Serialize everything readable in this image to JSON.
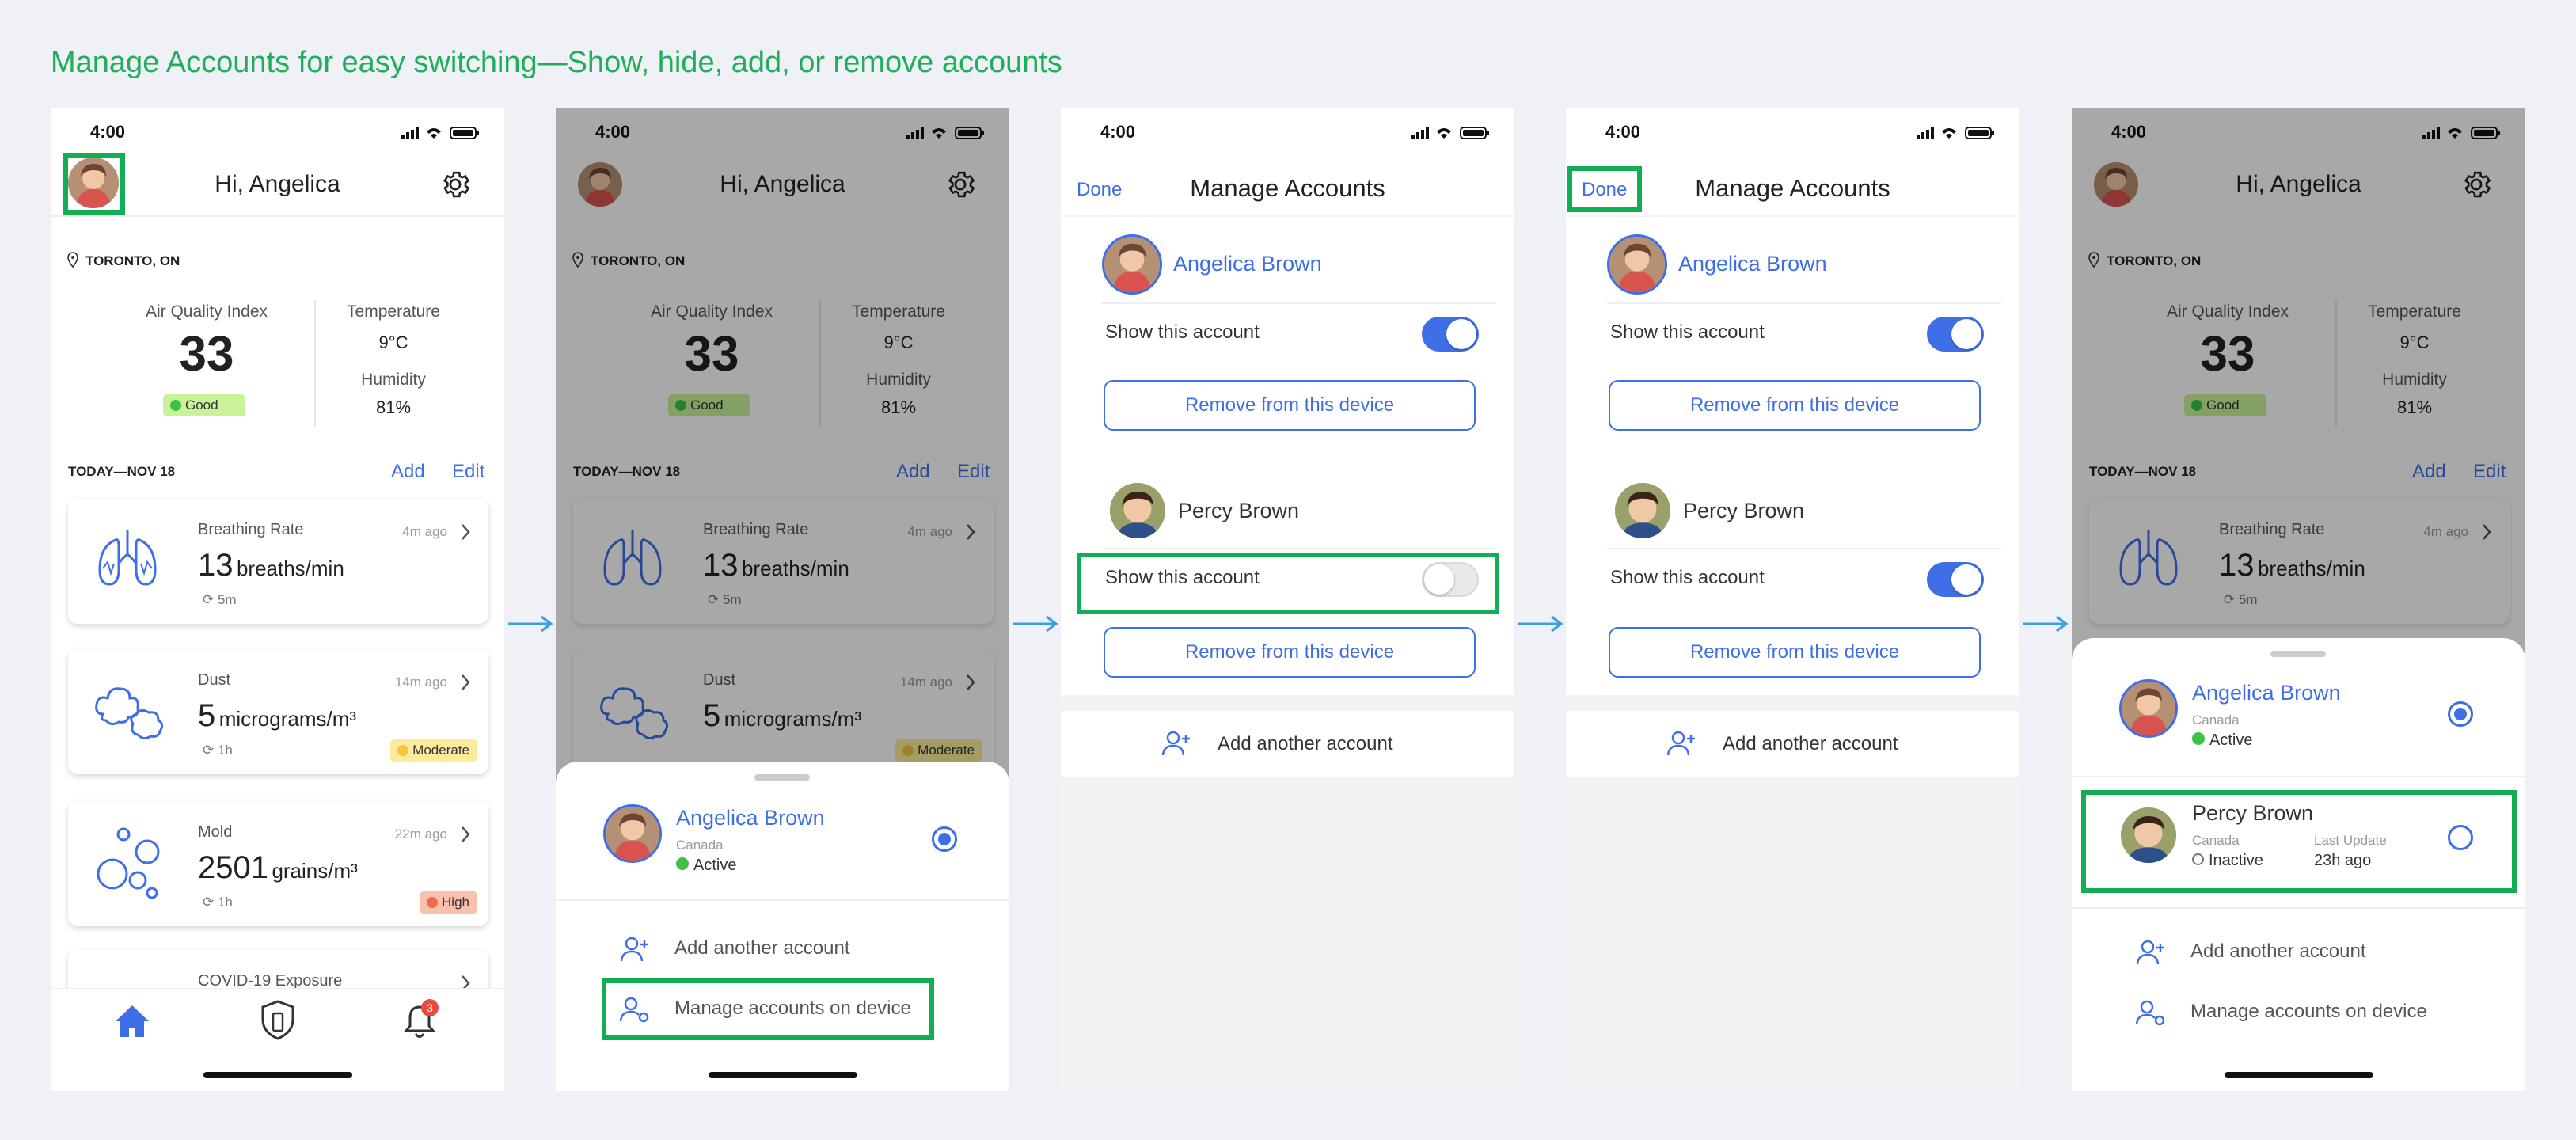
{
  "title": "Manage Accounts for easy switching—Show, hide, add, or remove accounts",
  "status_time": "4:00",
  "home": {
    "greeting": "Hi, Angelica",
    "location": "TORONTO, ON",
    "aqi_label": "Air Quality Index",
    "aqi_value": "33",
    "aqi_badge": "Good",
    "temp_label": "Temperature",
    "temp_value": "9°C",
    "humidity_label": "Humidity",
    "humidity_value": "81%",
    "today": "TODAY—NOV 18",
    "add": "Add",
    "edit": "Edit",
    "cards": [
      {
        "label": "Breathing Rate",
        "time": "4m ago",
        "value": "13",
        "unit": "breaths/min",
        "interval": "5m",
        "badge": ""
      },
      {
        "label": "Dust",
        "time": "14m ago",
        "value": "5",
        "unit": "micrograms/m³",
        "interval": "1h",
        "badge": "Moderate"
      },
      {
        "label": "Mold",
        "time": "22m ago",
        "value": "2501",
        "unit": "grains/m³",
        "interval": "1h",
        "badge": "High"
      },
      {
        "label": "COVID-19 Exposure",
        "time": "",
        "value": "",
        "unit": "",
        "interval": "",
        "badge": ""
      }
    ],
    "notif_count": "3"
  },
  "sheet": {
    "account1_name": "Angelica Brown",
    "account1_region": "Canada",
    "account1_status": "Active",
    "account2_name": "Percy Brown",
    "account2_region": "Canada",
    "account2_status": "Inactive",
    "last_update_label": "Last Update",
    "last_update_value": "23h ago",
    "add_account": "Add another account",
    "manage_accounts": "Manage accounts on device"
  },
  "manage": {
    "done": "Done",
    "title": "Manage Accounts",
    "account1": "Angelica Brown",
    "account2": "Percy Brown",
    "show": "Show this account",
    "remove": "Remove from this device",
    "add": "Add another account"
  },
  "colors": {
    "accent": "#3e6fe6",
    "highlight": "#13ad54",
    "good": "#3cc14a",
    "moderate": "#f3c43c",
    "high": "#f06b4d"
  }
}
